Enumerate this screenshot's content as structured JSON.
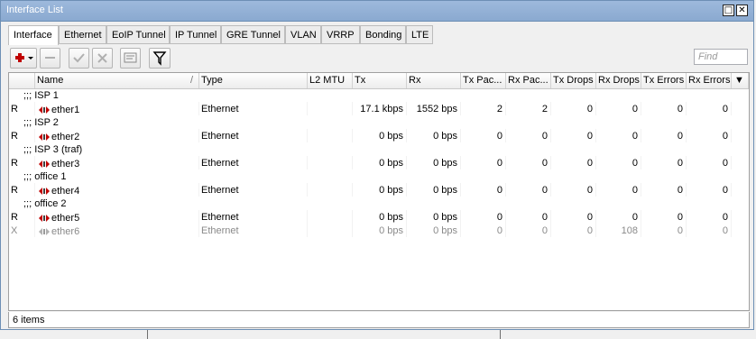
{
  "window": {
    "title": "Interface List",
    "restore_icon": "□",
    "close_icon": "✕"
  },
  "tabs": [
    "Interface",
    "Ethernet",
    "EoIP Tunnel",
    "IP Tunnel",
    "GRE Tunnel",
    "VLAN",
    "VRRP",
    "Bonding",
    "LTE"
  ],
  "toolbar": {
    "find_placeholder": "Find"
  },
  "columns": [
    "",
    "Name",
    "Type",
    "L2 MTU",
    "Tx",
    "Rx",
    "Tx Pac...",
    "Rx Pac...",
    "Tx Drops",
    "Rx Drops",
    "Tx Errors",
    "Rx Errors"
  ],
  "sort_indicator": "/",
  "column_menu_icon": "▼",
  "rows": [
    {
      "kind": "comment",
      "text": ";;; ISP 1"
    },
    {
      "kind": "item",
      "flag": "R",
      "name": "ether1",
      "type": "Ethernet",
      "l2mtu": "",
      "tx": "17.1 kbps",
      "rx": "1552 bps",
      "tx_pac": "2",
      "rx_pac": "2",
      "tx_drops": "0",
      "rx_drops": "0",
      "tx_err": "0",
      "rx_err": "0",
      "disabled": false
    },
    {
      "kind": "comment",
      "text": ";;; ISP 2"
    },
    {
      "kind": "item",
      "flag": "R",
      "name": "ether2",
      "type": "Ethernet",
      "l2mtu": "",
      "tx": "0 bps",
      "rx": "0 bps",
      "tx_pac": "0",
      "rx_pac": "0",
      "tx_drops": "0",
      "rx_drops": "0",
      "tx_err": "0",
      "rx_err": "0",
      "disabled": false
    },
    {
      "kind": "comment",
      "text": ";;; ISP 3 (traf)"
    },
    {
      "kind": "item",
      "flag": "R",
      "name": "ether3",
      "type": "Ethernet",
      "l2mtu": "",
      "tx": "0 bps",
      "rx": "0 bps",
      "tx_pac": "0",
      "rx_pac": "0",
      "tx_drops": "0",
      "rx_drops": "0",
      "tx_err": "0",
      "rx_err": "0",
      "disabled": false
    },
    {
      "kind": "comment",
      "text": ";;; office 1"
    },
    {
      "kind": "item",
      "flag": "R",
      "name": "ether4",
      "type": "Ethernet",
      "l2mtu": "",
      "tx": "0 bps",
      "rx": "0 bps",
      "tx_pac": "0",
      "rx_pac": "0",
      "tx_drops": "0",
      "rx_drops": "0",
      "tx_err": "0",
      "rx_err": "0",
      "disabled": false
    },
    {
      "kind": "comment",
      "text": ";;; office 2"
    },
    {
      "kind": "item",
      "flag": "R",
      "name": "ether5",
      "type": "Ethernet",
      "l2mtu": "",
      "tx": "0 bps",
      "rx": "0 bps",
      "tx_pac": "0",
      "rx_pac": "0",
      "tx_drops": "0",
      "rx_drops": "0",
      "tx_err": "0",
      "rx_err": "0",
      "disabled": false
    },
    {
      "kind": "item",
      "flag": "X",
      "name": "ether6",
      "type": "Ethernet",
      "l2mtu": "",
      "tx": "0 bps",
      "rx": "0 bps",
      "tx_pac": "0",
      "rx_pac": "0",
      "tx_drops": "0",
      "rx_drops": "108",
      "tx_err": "0",
      "rx_err": "0",
      "disabled": true
    }
  ],
  "status": "6 items",
  "colors": {
    "titlebar": "#9db9dc",
    "add_icon": "#c00000",
    "disabled_text": "#8a8a8a"
  }
}
